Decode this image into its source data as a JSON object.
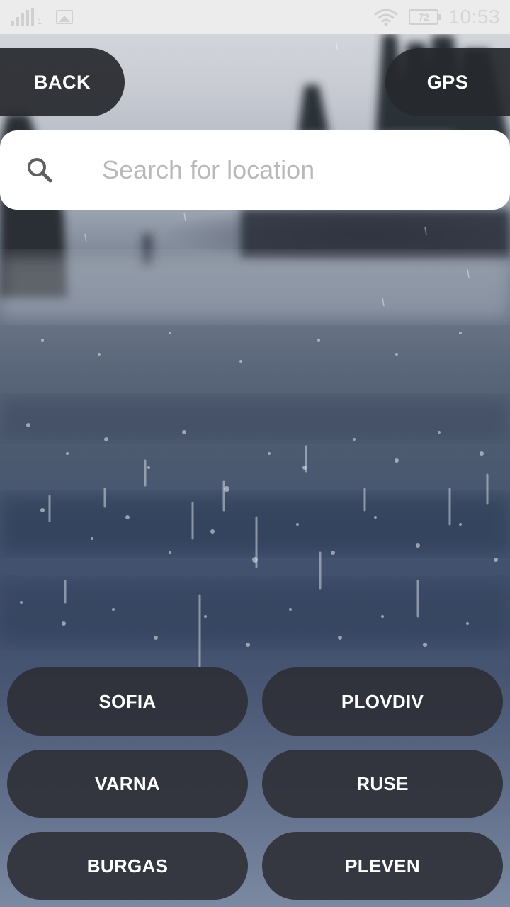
{
  "status_bar": {
    "signal_sub": "1",
    "battery_level": "72",
    "time": "10:53",
    "icons": [
      "signal-icon",
      "gallery-icon",
      "wifi-icon",
      "battery-icon"
    ]
  },
  "nav": {
    "back_label": "BACK",
    "gps_label": "GPS"
  },
  "search": {
    "placeholder": "Search for location",
    "value": "",
    "icon": "search-icon"
  },
  "cities": [
    {
      "label": "SOFIA"
    },
    {
      "label": "PLOVDIV"
    },
    {
      "label": "VARNA"
    },
    {
      "label": "RUSE"
    },
    {
      "label": "BURGAS"
    },
    {
      "label": "PLEVEN"
    }
  ],
  "colors": {
    "button_bg": "#2c2e34",
    "button_text": "#ffffff",
    "search_bg": "#ffffff",
    "placeholder": "#b9b9b9",
    "status_bar_bg": "#ececec"
  }
}
